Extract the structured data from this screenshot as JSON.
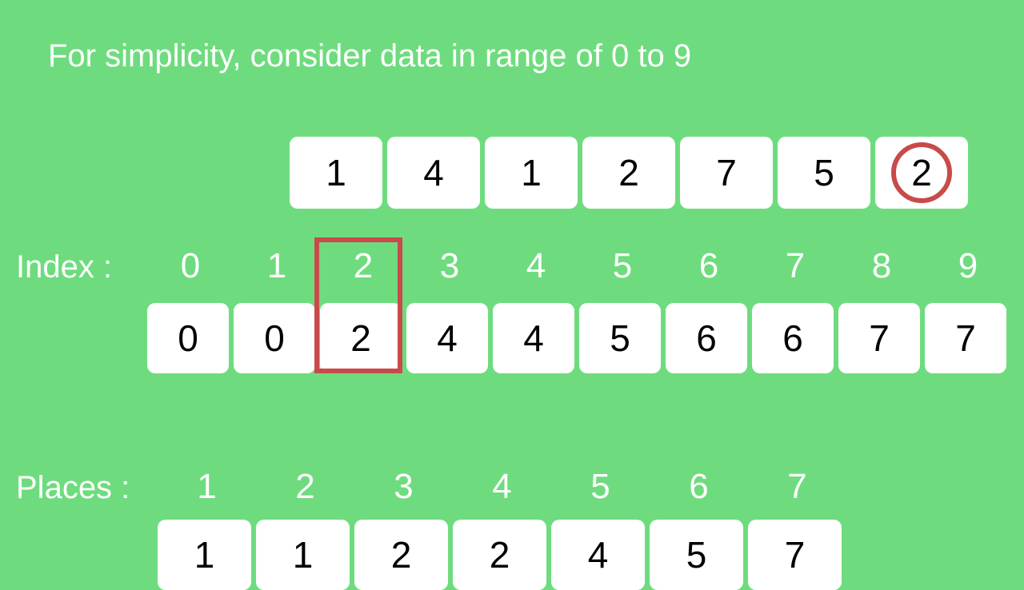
{
  "title": "For simplicity, consider data in range of 0 to 9",
  "input": [
    "1",
    "4",
    "1",
    "2",
    "7",
    "5",
    "2"
  ],
  "input_highlight_index": 6,
  "index_label": "Index :",
  "index_numbers": [
    "0",
    "1",
    "2",
    "3",
    "4",
    "5",
    "6",
    "7",
    "8",
    "9"
  ],
  "count_values": [
    "0",
    "0",
    "2",
    "4",
    "4",
    "5",
    "6",
    "6",
    "7",
    "7"
  ],
  "count_highlight_index": 2,
  "places_label": "Places :",
  "places_numbers": [
    "1",
    "2",
    "3",
    "4",
    "5",
    "6",
    "7"
  ],
  "output": [
    "1",
    "1",
    "2",
    "2",
    "4",
    "5",
    "7"
  ]
}
